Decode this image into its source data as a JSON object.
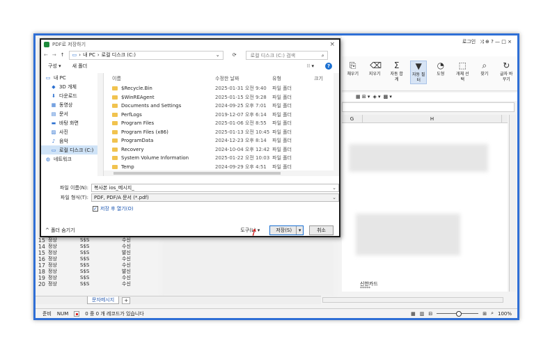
{
  "dialog": {
    "title": "PDF로 저장하기",
    "close": "×",
    "nav_back": "←",
    "nav_forward": "→",
    "nav_up": "↑",
    "path": [
      "내 PC",
      "›",
      "로컬 디스크 (C:)"
    ],
    "path_prefix": "›",
    "refresh": "⟳",
    "search_placeholder": "로컬 디스크 (C:) 검색",
    "organize": "구성 ▾",
    "new_folder": "새 폴더",
    "view": "⁝⁝ ▾",
    "help": "?",
    "nav_items": [
      {
        "icon": "pc-icon",
        "label": "내 PC",
        "glyph": "▭"
      },
      {
        "icon": "3d-objects-icon",
        "label": "3D 개체",
        "glyph": "◆"
      },
      {
        "icon": "downloads-icon",
        "label": "다운로드",
        "glyph": "⬇"
      },
      {
        "icon": "videos-icon",
        "label": "동영상",
        "glyph": "▦"
      },
      {
        "icon": "documents-icon",
        "label": "문서",
        "glyph": "▤"
      },
      {
        "icon": "desktop-icon",
        "label": "바탕 화면",
        "glyph": "▬"
      },
      {
        "icon": "pictures-icon",
        "label": "사진",
        "glyph": "▨"
      },
      {
        "icon": "music-icon",
        "label": "음악",
        "glyph": "♪"
      },
      {
        "icon": "local-disk-icon",
        "label": "로컬 디스크 (C:)",
        "glyph": "▭"
      },
      {
        "icon": "network-icon",
        "label": "네트워크",
        "glyph": "◍"
      }
    ],
    "columns": {
      "name": "이름",
      "modified": "수정한 날짜",
      "type": "유형",
      "size": "크기"
    },
    "files": [
      {
        "name": "$Recycle.Bin",
        "modified": "2025-01-31 오전 9:40",
        "type": "파일 폴더"
      },
      {
        "name": "$WinREAgent",
        "modified": "2025-01-15 오전 9:28",
        "type": "파일 폴더"
      },
      {
        "name": "Documents and Settings",
        "modified": "2024-09-25 오후 7:01",
        "type": "파일 폴더"
      },
      {
        "name": "PerfLogs",
        "modified": "2019-12-07 오후 6:14",
        "type": "파일 폴더"
      },
      {
        "name": "Program Files",
        "modified": "2025-01-06 오전 8:55",
        "type": "파일 폴더"
      },
      {
        "name": "Program Files (x86)",
        "modified": "2025-01-13 오전 10:45",
        "type": "파일 폴더"
      },
      {
        "name": "ProgramData",
        "modified": "2024-12-23 오후 8:14",
        "type": "파일 폴더"
      },
      {
        "name": "Recovery",
        "modified": "2024-10-04 오후 12:42",
        "type": "파일 폴더"
      },
      {
        "name": "System Volume Information",
        "modified": "2025-01-22 오전 10:03",
        "type": "파일 폴더"
      },
      {
        "name": "Temp",
        "modified": "2024-09-29 오후 4:51",
        "type": "파일 폴더"
      }
    ],
    "filename_label": "파일 이름(N):",
    "filename_value": "복사본 ios_메시지_",
    "filetype_label": "파일 형식(T):",
    "filetype_value": "PDF, PDF/A 문서 (*.pdf)",
    "open_after_save": "저장 후 열기(O)",
    "hide_folders": "^ 폴더 숨기기",
    "tools": "도구(L)  ▾",
    "save": "저장(S)",
    "save_arrow": "▾",
    "cancel": "취소"
  },
  "app": {
    "login": "로그인",
    "title_icons": "⤨ ⊕ ?  —  □  ×",
    "ribbon": [
      {
        "icon": "fill-icon",
        "glyph": "⎘",
        "label": "채우기"
      },
      {
        "icon": "clear-icon",
        "glyph": "⌫",
        "label": "지우기"
      },
      {
        "icon": "autosum-icon",
        "glyph": "Σ",
        "label": "자동 합계"
      },
      {
        "icon": "autofilter-icon",
        "glyph": "▼",
        "label": "자동 필터"
      },
      {
        "icon": "shapes-icon",
        "glyph": "◔",
        "label": "도형"
      },
      {
        "icon": "select-object-icon",
        "glyph": "⬚",
        "label": "개체 선택"
      },
      {
        "icon": "find-icon",
        "glyph": "⌕",
        "label": "찾기"
      },
      {
        "icon": "replace-icon",
        "glyph": "↻",
        "label": "글자 바꾸기"
      }
    ],
    "columns": [
      "G",
      "H"
    ],
    "card_text": "신한카드",
    "card_sub": "*****",
    "rows": [
      {
        "n": "15",
        "c1": "정상",
        "c2": "S$S",
        "c3": "수신"
      },
      {
        "n": "14",
        "c1": "정상",
        "c2": "S$S",
        "c3": "수신"
      },
      {
        "n": "15",
        "c1": "정상",
        "c2": "S$S",
        "c3": "발신"
      },
      {
        "n": "16",
        "c1": "정상",
        "c2": "S$S",
        "c3": "수신"
      },
      {
        "n": "17",
        "c1": "정상",
        "c2": "S$S",
        "c3": "수신"
      },
      {
        "n": "18",
        "c1": "정상",
        "c2": "S$S",
        "c3": "발신"
      },
      {
        "n": "19",
        "c1": "정상",
        "c2": "S$S",
        "c3": "수신"
      },
      {
        "n": "20",
        "c1": "정상",
        "c2": "S$S",
        "c3": "수신"
      }
    ],
    "sheet_tab": "문자메시지",
    "add_sheet": "+",
    "status_ready": "준비",
    "status_num": "NUM",
    "status_records": "0 중 0 개 레코드가 있습니다",
    "zoom": "100%"
  }
}
